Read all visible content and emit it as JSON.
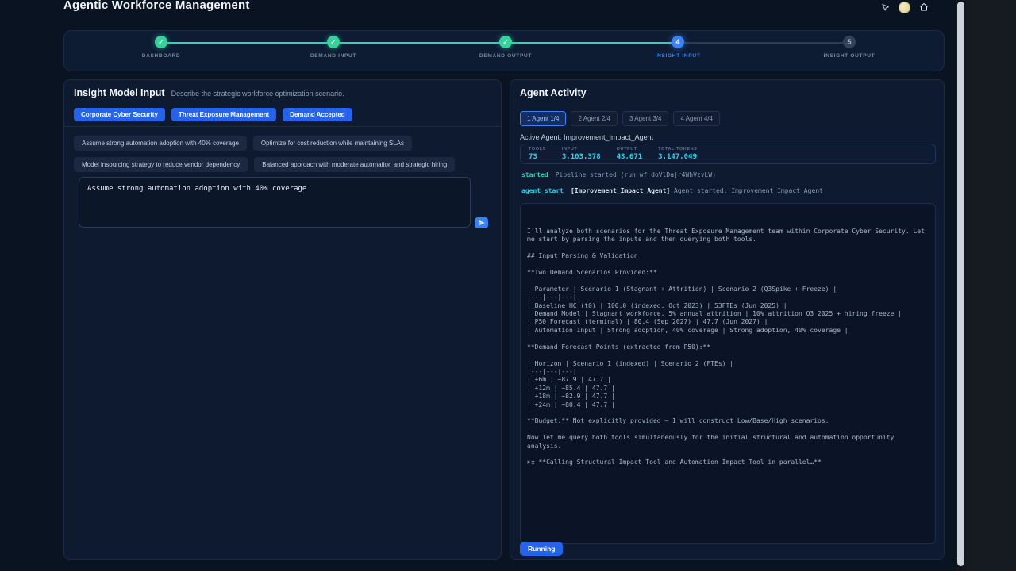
{
  "colors": {
    "accent_blue": "#2563eb",
    "teal": "#2dd4bf",
    "cyan": "#22d3ee"
  },
  "header": {
    "title": "Agentic Workforce Management"
  },
  "stepper": {
    "steps": [
      {
        "label": "DASHBOARD",
        "symbol": "✓",
        "state": "completed"
      },
      {
        "label": "DEMAND INPUT",
        "symbol": "✓",
        "state": "completed"
      },
      {
        "label": "DEMAND OUTPUT",
        "symbol": "✓",
        "state": "completed"
      },
      {
        "label": "INSIGHT INPUT",
        "symbol": "4",
        "state": "active"
      },
      {
        "label": "INSIGHT OUTPUT",
        "symbol": "5",
        "state": "upcoming"
      }
    ]
  },
  "left_panel": {
    "title": "Insight Model Input",
    "subtitle": "Describe the strategic workforce optimization scenario.",
    "pills": [
      "Corporate Cyber Security",
      "Threat Exposure Management",
      "Demand Accepted"
    ],
    "suggestions": [
      "Assume strong automation adoption with 40% coverage",
      "Optimize for cost reduction while maintaining SLAs",
      "Model insourcing strategy to reduce vendor dependency",
      "Balanced approach with moderate automation and strategic hiring"
    ],
    "textarea_value": "Assume strong automation adoption with 40% coverage"
  },
  "right_panel": {
    "title": "Agent Activity",
    "tabs": [
      {
        "label": "1 Agent 1/4",
        "active": true
      },
      {
        "label": "2 Agent 2/4",
        "active": false
      },
      {
        "label": "3 Agent 3/4",
        "active": false
      },
      {
        "label": "4 Agent 4/4",
        "active": false
      }
    ],
    "active_agent_label": "Active Agent: Improvement_Impact_Agent",
    "stats": [
      {
        "label": "TOOLS",
        "value": "73"
      },
      {
        "label": "INPUT",
        "value": "3,103,378"
      },
      {
        "label": "OUTPUT",
        "value": "43,671"
      },
      {
        "label": "TOTAL TOKENS",
        "value": "3,147,049"
      }
    ],
    "events": [
      {
        "type": "started",
        "message": "Pipeline started (run wf_doVlDajr4WhVzvLW)"
      },
      {
        "type": "agent_start",
        "agent": "[Improvement_Impact_Agent]",
        "message": "Agent started: Improvement_Impact_Agent"
      }
    ],
    "log_text": "I'll analyze both scenarios for the Threat Exposure Management team within Corporate Cyber Security. Let me start by parsing the inputs and then querying both tools.\n\n## Input Parsing & Validation\n\n**Two Demand Scenarios Provided:**\n\n| Parameter | Scenario 1 (Stagnant + Attrition) | Scenario 2 (Q3Spike + Freeze) |\n|---|---|---|\n| Baseline HC (t0) | 100.0 (indexed, Oct 2023) | 53FTEs (Jun 2025) |\n| Demand Model | Stagnant workforce, 5% annual attrition | 10% attrition Q3 2025 + hiring freeze |\n| P50 Forecast (terminal) | 80.4 (Sep 2027) | 47.7 (Jun 2027) |\n| Automation Input | Strong adoption, 40% coverage | Strong adoption, 40% coverage |\n\n**Demand Forecast Points (extracted from P50):**\n\n| Horizon | Scenario 1 (indexed) | Scenario 2 (FTEs) |\n|---|---|---|\n| +6m | ~87.9 | 47.7 |\n| +12m | ~85.4 | 47.7 |\n| +18m | ~82.9 | 47.7 |\n| +24m | ~80.4 | 47.7 |\n\n**Budget:** Not explicitly provided — I will construct Low/Base/High scenarios.\n\nNow let me query both tools simultaneously for the initial structural and automation opportunity analysis.\n\n>⚒ **Calling Structural Impact Tool and Automation Impact Tool in parallel…**",
    "status_badge": "Running"
  }
}
